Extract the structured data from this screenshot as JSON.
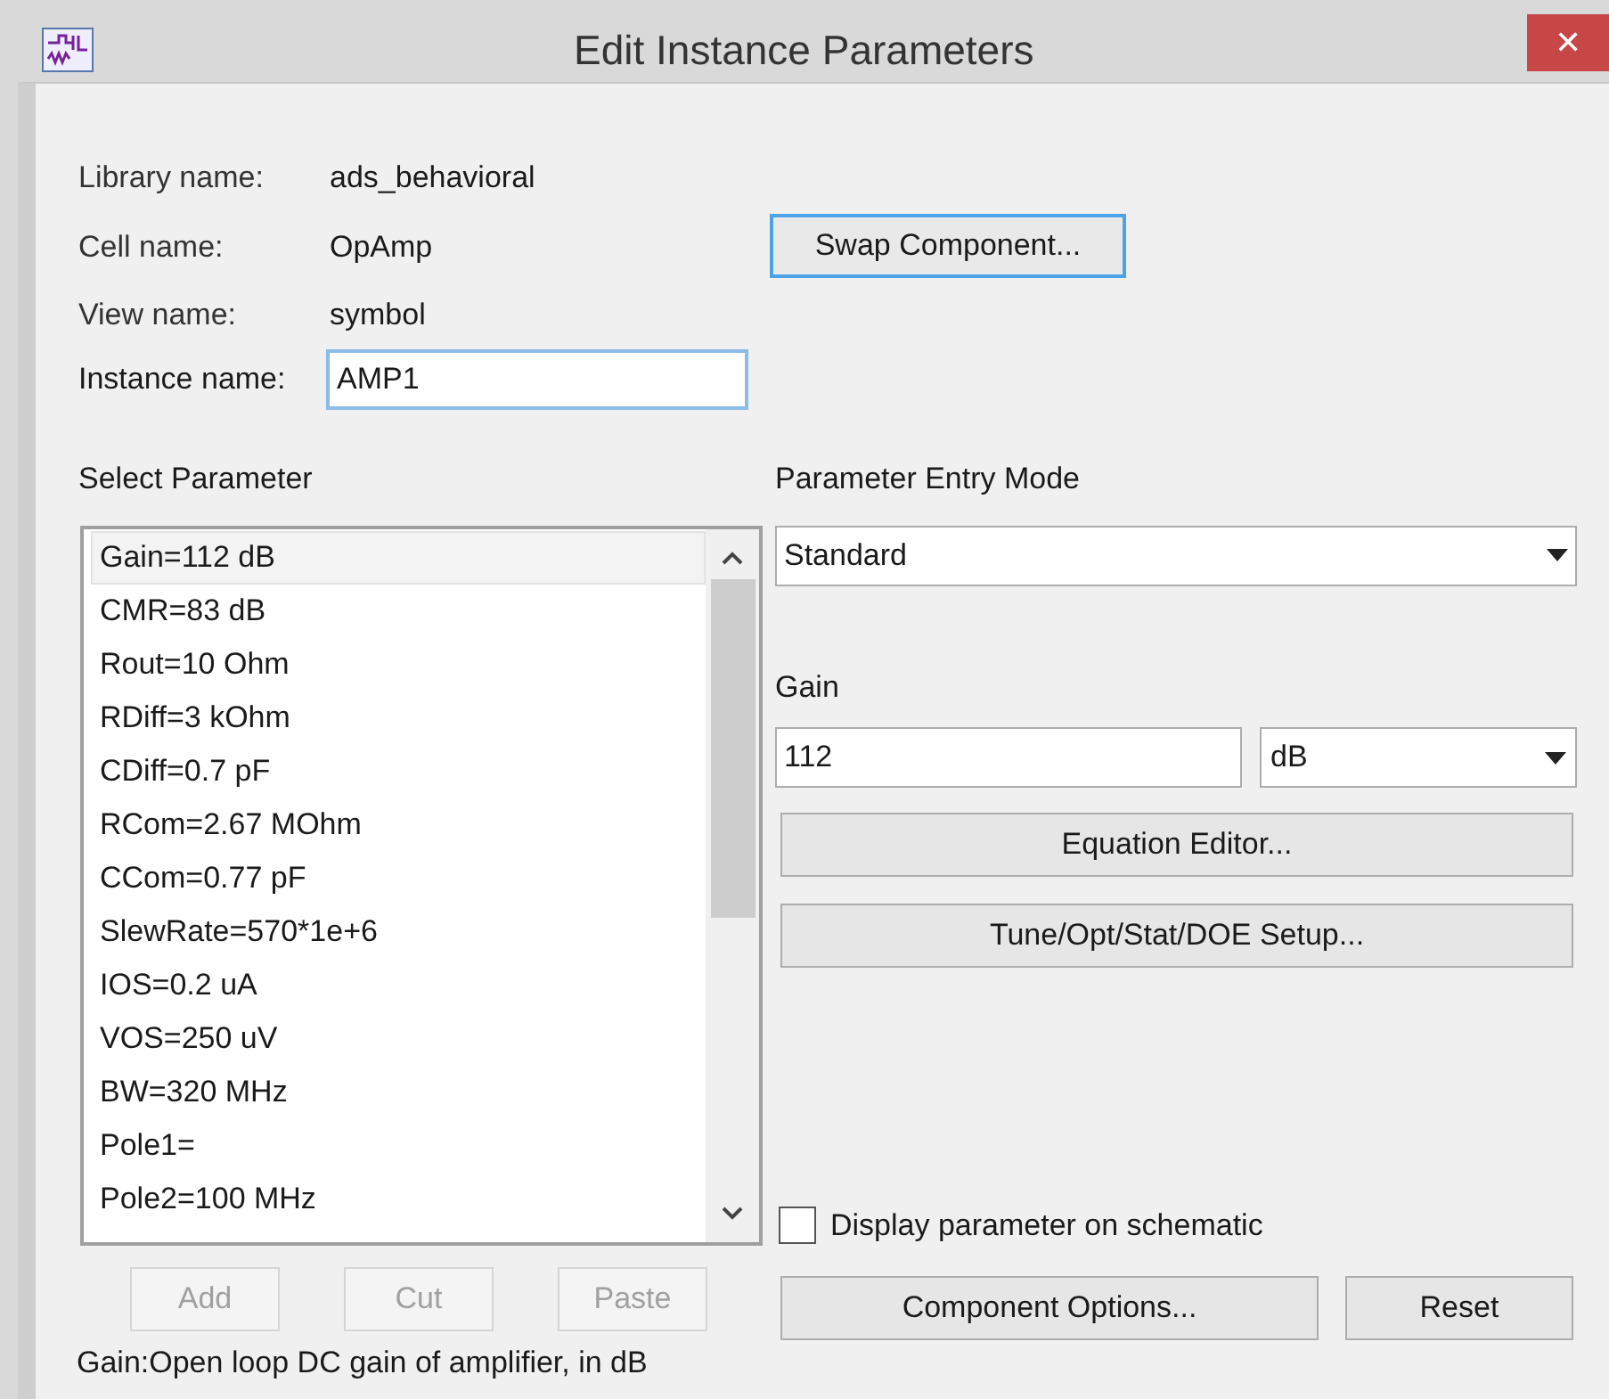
{
  "window": {
    "title": "Edit Instance Parameters",
    "close": "✕"
  },
  "info": [
    {
      "label": "Library name:",
      "value": "ads_behavioral"
    },
    {
      "label": "Cell name:",
      "value": "OpAmp"
    },
    {
      "label": "View name:",
      "value": "symbol"
    }
  ],
  "swap_button": "Swap Component...",
  "instance_name": {
    "label": "Instance name:",
    "value": "AMP1"
  },
  "select_parameter": {
    "label": "Select Parameter",
    "items": [
      {
        "text": "Gain=112 dB",
        "selected": true
      },
      {
        "text": "CMR=83 dB",
        "selected": false
      },
      {
        "text": "Rout=10 Ohm",
        "selected": false
      },
      {
        "text": "RDiff=3 kOhm",
        "selected": false
      },
      {
        "text": "CDiff=0.7 pF",
        "selected": false
      },
      {
        "text": "RCom=2.67 MOhm",
        "selected": false
      },
      {
        "text": "CCom=0.77 pF",
        "selected": false
      },
      {
        "text": "SlewRate=570*1e+6",
        "selected": false
      },
      {
        "text": "IOS=0.2 uA",
        "selected": false
      },
      {
        "text": "VOS=250 uV",
        "selected": false
      },
      {
        "text": "BW=320 MHz",
        "selected": false
      },
      {
        "text": "Pole1=",
        "selected": false
      },
      {
        "text": "Pole2=100 MHz",
        "selected": false
      }
    ]
  },
  "entry_mode": {
    "label": "Parameter Entry Mode",
    "value": "Standard"
  },
  "parameter": {
    "label": "Gain",
    "value": "112",
    "unit": "dB"
  },
  "action_buttons": [
    {
      "label": "Equation Editor...",
      "disabled": false
    },
    {
      "label": "Tune/Opt/Stat/DOE Setup...",
      "disabled": false
    }
  ],
  "display_on_schematic": {
    "label": "Display parameter on schematic",
    "checked": false
  },
  "list_buttons": [
    {
      "label": "Add",
      "disabled": true
    },
    {
      "label": "Cut",
      "disabled": true
    },
    {
      "label": "Paste",
      "disabled": true
    }
  ],
  "dialog_buttons": [
    {
      "label": "Component Options...",
      "disabled": false
    },
    {
      "label": "Reset",
      "disabled": false
    }
  ],
  "status": "Gain:Open loop DC gain of amplifier, in dB"
}
